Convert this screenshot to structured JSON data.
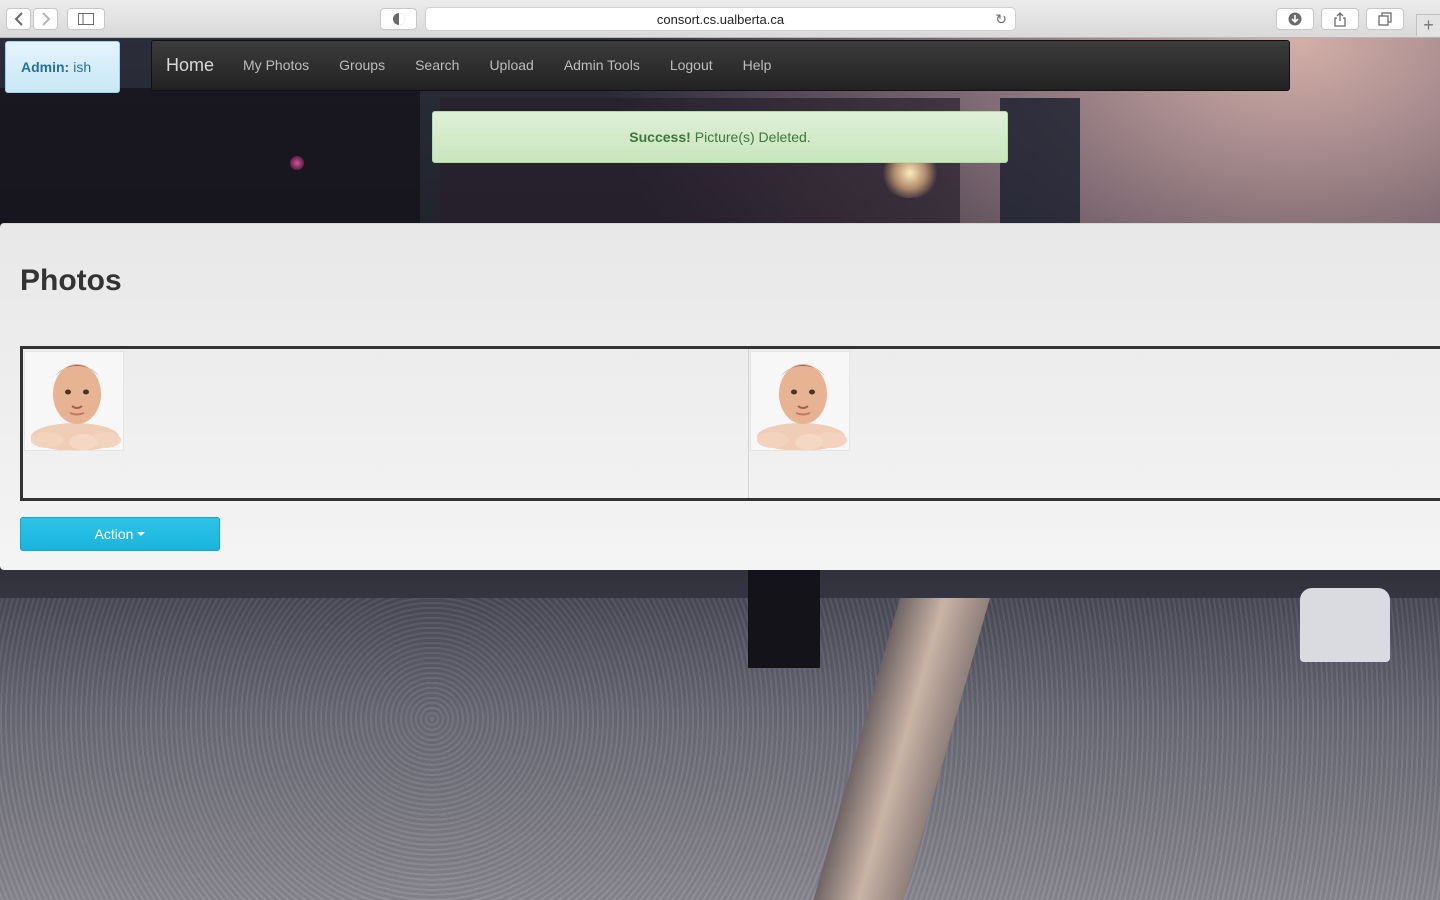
{
  "browser": {
    "url": "consort.cs.ualberta.ca"
  },
  "admin": {
    "label": "Admin:",
    "user": "ish"
  },
  "nav": {
    "brand": "Home",
    "items": [
      {
        "label": "My Photos"
      },
      {
        "label": "Groups"
      },
      {
        "label": "Search"
      },
      {
        "label": "Upload"
      },
      {
        "label": "Admin Tools"
      },
      {
        "label": "Logout"
      },
      {
        "label": "Help"
      }
    ]
  },
  "alert": {
    "strong": "Success!",
    "message": "Picture(s) Deleted."
  },
  "main": {
    "title": "Photos",
    "photos_count": 2,
    "action_label": "Action"
  },
  "colors": {
    "accent": "#1ab4dc",
    "success_text": "#3c763d",
    "navbar": "#2a2a2a"
  }
}
